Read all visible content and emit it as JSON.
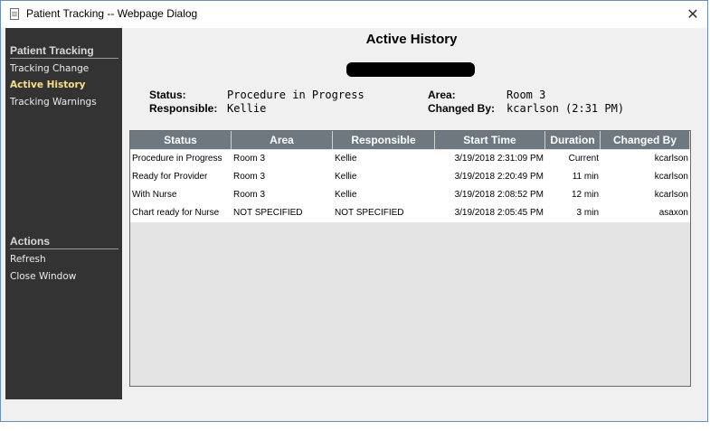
{
  "window": {
    "title": "Patient Tracking -- Webpage Dialog",
    "close_glyph": "✕"
  },
  "sidebar": {
    "sections": [
      {
        "heading": "Patient Tracking",
        "items": [
          {
            "label": "Tracking Change",
            "active": false
          },
          {
            "label": "Active History",
            "active": true
          },
          {
            "label": "Tracking Warnings",
            "active": false
          }
        ]
      },
      {
        "heading": "Actions",
        "items": [
          {
            "label": "Refresh"
          },
          {
            "label": "Close Window"
          }
        ]
      }
    ]
  },
  "main": {
    "heading": "Active History",
    "status_label": "Status:",
    "status_value": "Procedure in Progress",
    "responsible_label": "Responsible:",
    "responsible_value": "Kellie",
    "area_label": "Area:",
    "area_value": "Room 3",
    "changed_by_label": "Changed By:",
    "changed_by_value": "kcarlson (2:31 PM)"
  },
  "table": {
    "columns": [
      "Status",
      "Area",
      "Responsible",
      "Start Time",
      "Duration",
      "Changed By"
    ],
    "rows": [
      [
        "Procedure in Progress",
        "Room 3",
        "Kellie",
        "3/19/2018 2:31:09 PM",
        "Current",
        "kcarlson"
      ],
      [
        "Ready for Provider",
        "Room 3",
        "Kellie",
        "3/19/2018 2:20:49 PM",
        "11 min",
        "kcarlson"
      ],
      [
        "With Nurse",
        "Room 3",
        "Kellie",
        "3/19/2018 2:08:52 PM",
        "12 min",
        "kcarlson"
      ],
      [
        "Chart ready for Nurse",
        "NOT SPECIFIED",
        "NOT SPECIFIED",
        "3/19/2018 2:05:45 PM",
        "3 min",
        "asaxon"
      ]
    ]
  },
  "colors": {
    "sidebar_bg": "#333333",
    "active_item": "#f5e08a",
    "header_bg": "#6e7880"
  }
}
